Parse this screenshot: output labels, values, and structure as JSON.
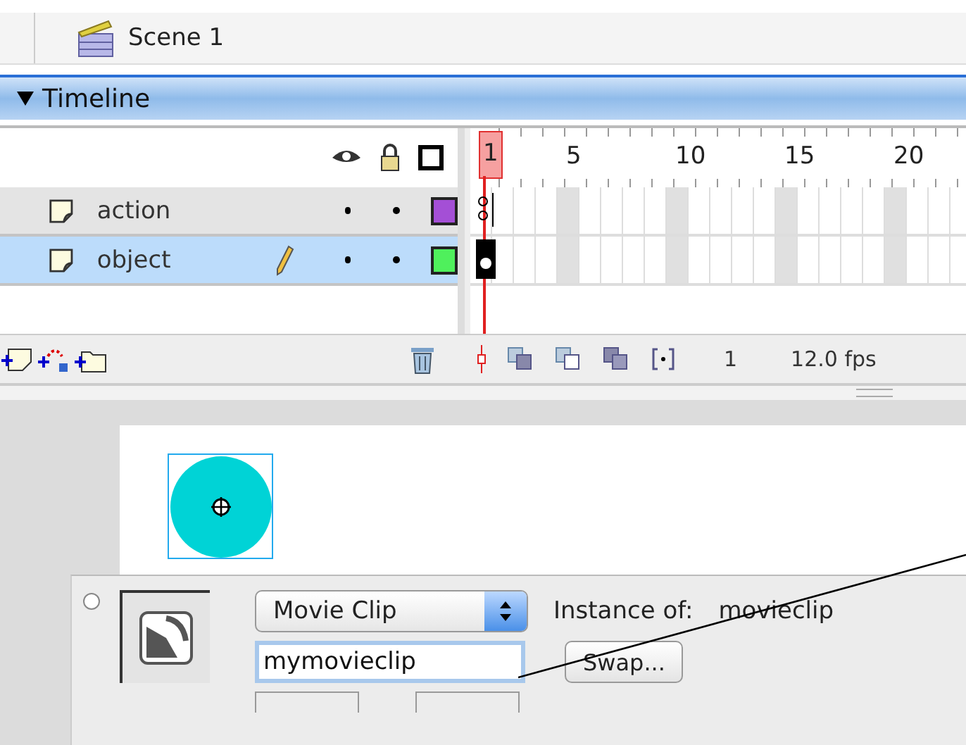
{
  "scene_bar": {
    "scene": "Scene 1"
  },
  "timeline": {
    "title": "Timeline",
    "expanded": true,
    "ruler": [
      "1",
      "5",
      "10",
      "15",
      "20"
    ],
    "layers": [
      {
        "name": "action",
        "selected": false,
        "editing": false,
        "color": "#a44fd6",
        "kind": "actions"
      },
      {
        "name": "object",
        "selected": true,
        "editing": true,
        "color": "#4ff05c",
        "kind": "filled"
      }
    ],
    "current_frame": "1",
    "frame_rate": "12.0 fps"
  },
  "properties": {
    "symbol_type": "Movie Clip",
    "instance_of_label": "Instance of:",
    "instance_of": "movieclip",
    "instance_name": "mymovieclip",
    "swap_button": "Swap..."
  }
}
